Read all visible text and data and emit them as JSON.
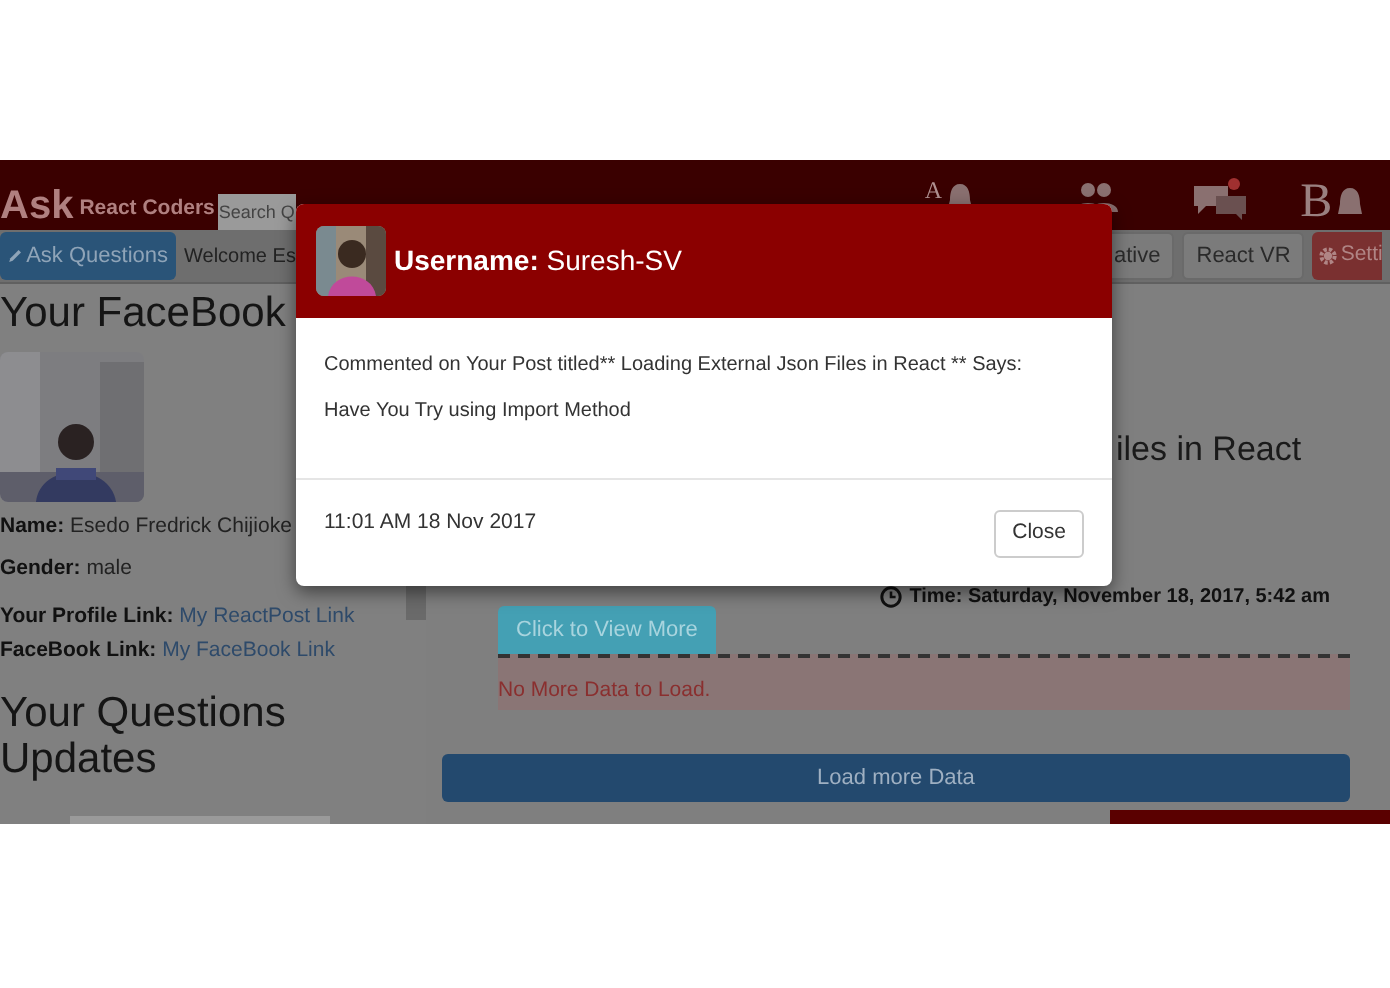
{
  "navbar": {
    "logo": "Ask",
    "subtitle": "React Coders",
    "search": {
      "placeholder": "Search Q"
    },
    "letters": [
      "A",
      "B"
    ]
  },
  "toolbar": {
    "items": [
      {
        "kind": "primary",
        "label": "Ask Questions"
      },
      {
        "kind": "text",
        "label": "Welcome Es"
      },
      {
        "kind": "default",
        "label": "ative"
      },
      {
        "kind": "default",
        "label": "React VR"
      },
      {
        "kind": "danger",
        "label": "Setti"
      }
    ]
  },
  "profile": {
    "title": "Your FaceBook",
    "fields": [
      {
        "kind": "text",
        "label": "Name:",
        "value": "Esedo Fredrick Chijioke"
      },
      {
        "kind": "text",
        "label": "Gender:",
        "value": "male"
      },
      {
        "kind": "link",
        "label": "Your Profile Link:",
        "value": "My ReactPost Link"
      },
      {
        "kind": "link",
        "label": "FaceBook Link:",
        "value": "My FaceBook Link"
      }
    ]
  },
  "questions_title": "Your Questions Updates",
  "post": {
    "title": "iles in React",
    "time": "Time: Saturday, November 18, 2017, 5:42 am",
    "view_more": "Click to View More",
    "no_more": "No More Data to Load.",
    "load_more": "Load more Data"
  },
  "modal": {
    "header": "**Username:** Suresh-SV",
    "message": "Commented on Your Post titled** Loading External Json Files in React ** Says:",
    "comment": "Have You Try using Import Method",
    "timestamp": "11:01 AM 18 Nov 2017",
    "close": "Close"
  }
}
